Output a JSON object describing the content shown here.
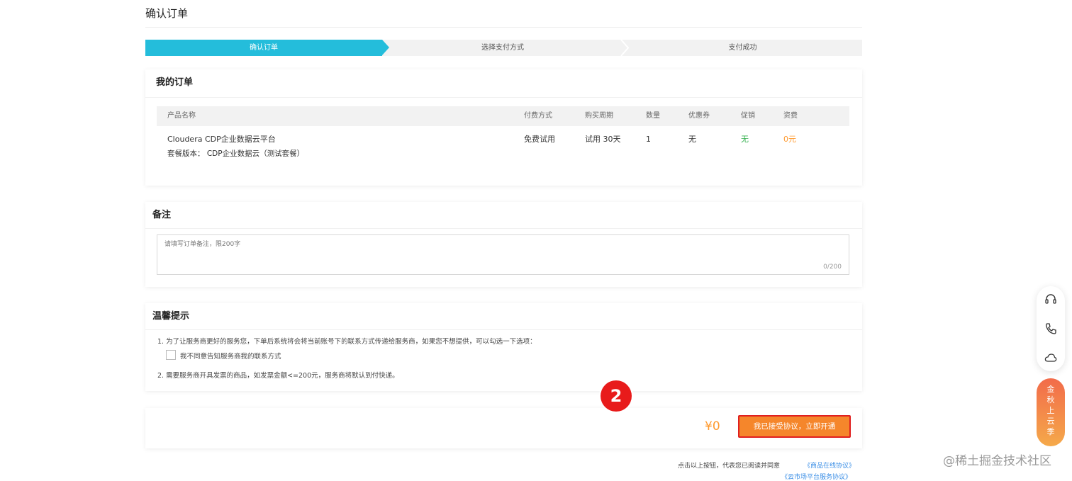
{
  "page": {
    "title": "确认订单"
  },
  "steps": [
    {
      "label": "确认订单",
      "active": true
    },
    {
      "label": "选择支付方式",
      "active": false
    },
    {
      "label": "支付成功",
      "active": false
    }
  ],
  "order": {
    "heading": "我的订单",
    "columns": [
      "产品名称",
      "付费方式",
      "购买周期",
      "数量",
      "优惠券",
      "促销",
      "资费"
    ],
    "row": {
      "product_name": "Cloudera CDP企业数据云平台",
      "package": "套餐版本：  CDP企业数据云（测试套餐）",
      "payment": "免费试用",
      "period": "试用 30天",
      "quantity": "1",
      "coupon": "无",
      "promotion": "无",
      "price": "0元"
    }
  },
  "remark": {
    "heading": "备注",
    "placeholder": "请填写订单备注，限200字",
    "counter": "0/200"
  },
  "tips": {
    "heading": "温馨提示",
    "line1": "1. 为了让服务商更好的服务您，下单后系统将会将当前账号下的联系方式传递给服务商，如果您不想提供，可以勾选一下选项：",
    "checkbox_label": "我不同意告知服务商我的联系方式",
    "line2": "2. 需要服务商开具发票的商品，如发票金额<=200元，服务商将默认到付快递。"
  },
  "footer": {
    "total": "¥0",
    "submit_label": "我已接受协议，立即开通",
    "step_badge": "2",
    "agree_note": "点击以上按钮，代表您已阅读并同意",
    "link1": "《商品在线协议》",
    "link2": "《云市场平台服务协议》"
  },
  "side": {
    "icons": [
      "headset-icon",
      "phone-icon",
      "cloud-icon"
    ],
    "promo_chars": [
      "金",
      "秋",
      "上",
      "云",
      "季"
    ]
  },
  "watermark": "@稀土掘金技术社区",
  "colors": {
    "accent": "#24bddb",
    "button": "#f5862b",
    "price": "#ff9a2e",
    "badge": "#e81b1b",
    "free": "#34b04e"
  }
}
